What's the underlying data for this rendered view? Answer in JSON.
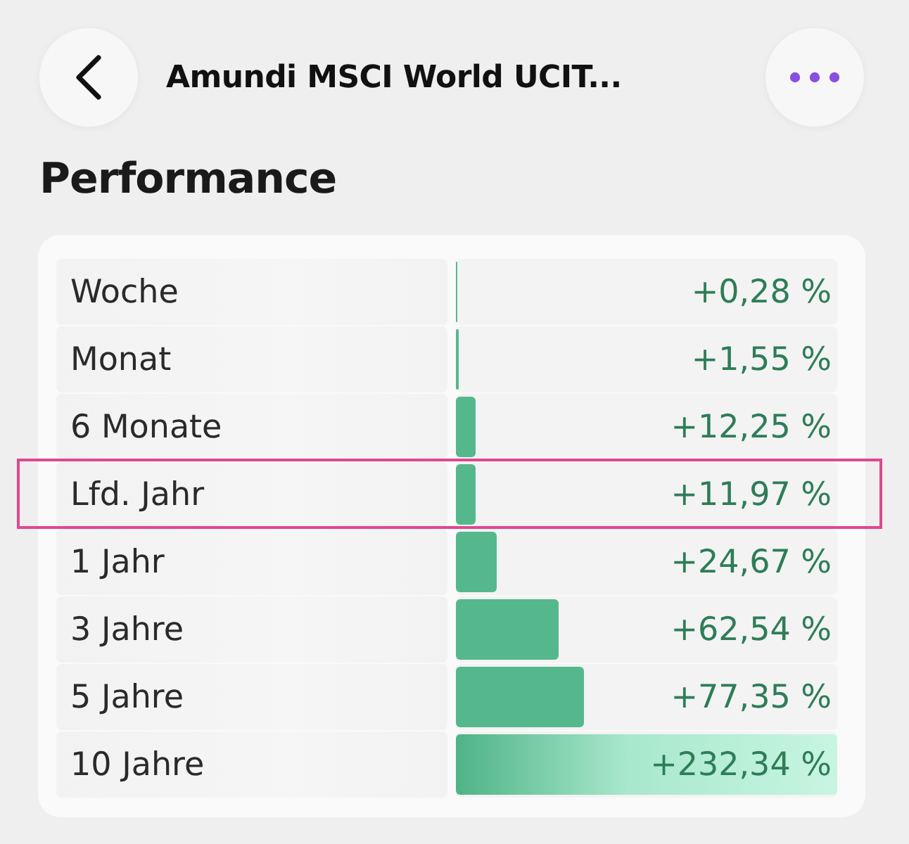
{
  "header": {
    "title": "Amundi MSCI World UCIT..."
  },
  "section_title": "Performance",
  "rows": [
    {
      "label": "Woche",
      "value": "+0,28 %",
      "level": 0.002,
      "highlighted": false
    },
    {
      "label": "Monat",
      "value": "+1,55 %",
      "level": 0.008,
      "highlighted": false
    },
    {
      "label": "6 Monate",
      "value": "+12,25 %",
      "level": 0.053,
      "highlighted": false
    },
    {
      "label": "Lfd. Jahr",
      "value": "+11,97 %",
      "level": 0.052,
      "highlighted": true
    },
    {
      "label": "1 Jahr",
      "value": "+24,67 %",
      "level": 0.107,
      "highlighted": false
    },
    {
      "label": "3 Jahre",
      "value": "+62,54 %",
      "level": 0.27,
      "highlighted": false
    },
    {
      "label": "5 Jahre",
      "value": "+77,35 %",
      "level": 0.336,
      "highlighted": false
    },
    {
      "label": "10 Jahre",
      "value": "+232,34 %",
      "level": 1,
      "highlighted": false
    }
  ]
}
